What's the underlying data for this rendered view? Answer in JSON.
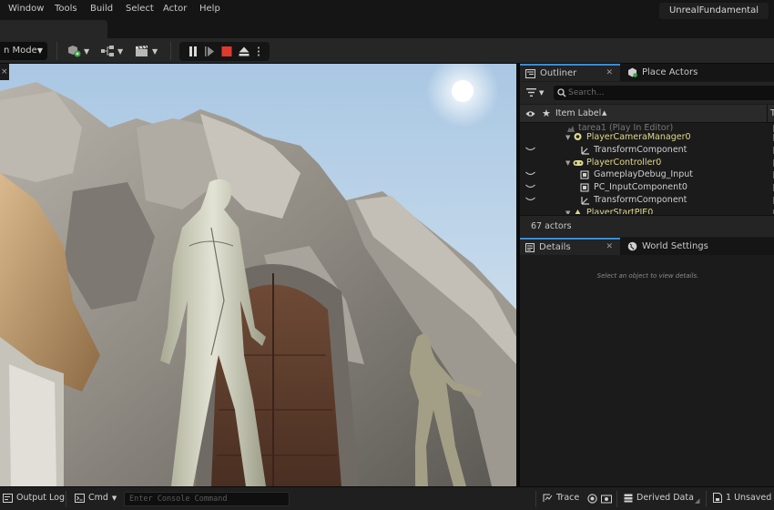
{
  "menu": {
    "items": [
      "Window",
      "Tools",
      "Build",
      "Select",
      "Actor",
      "Help"
    ],
    "project_name": "UnrealFundamental"
  },
  "toolbar": {
    "mode_label": "n Mode"
  },
  "outliner": {
    "tab_label": "Outliner",
    "place_actors_label": "Place Actors",
    "search_placeholder": "Search...",
    "column_item_label": "Item Label",
    "sort_indicator": "▲",
    "column_type_partial": "T",
    "rows": [
      {
        "label": "tarea1 (Play In Editor)",
        "kind": "world",
        "indent": 0
      },
      {
        "label": "PlayerCameraManager0",
        "kind": "actor",
        "indent": 1
      },
      {
        "label": "TransformComponent",
        "kind": "comp",
        "indent": 2
      },
      {
        "label": "PlayerController0",
        "kind": "actor",
        "indent": 1
      },
      {
        "label": "GameplayDebug_Input",
        "kind": "comp",
        "indent": 2
      },
      {
        "label": "PC_InputComponent0",
        "kind": "comp",
        "indent": 2
      },
      {
        "label": "TransformComponent",
        "kind": "comp",
        "indent": 2
      },
      {
        "label": "PlayerStartPIE0",
        "kind": "actor",
        "indent": 1
      }
    ],
    "actor_count": "67 actors"
  },
  "details": {
    "tab_label": "Details",
    "world_settings_label": "World Settings",
    "empty_message": "Select an object to view details."
  },
  "statusbar": {
    "output_log": "Output Log",
    "cmd": "Cmd",
    "console_placeholder": "Enter Console Command",
    "trace": "Trace",
    "derived_data": "Derived Data",
    "unsaved": "1 Unsaved"
  },
  "colors": {
    "accent": "#3b8cd6",
    "stop_red": "#e03a2f",
    "actor_label": "#e2d98a"
  }
}
